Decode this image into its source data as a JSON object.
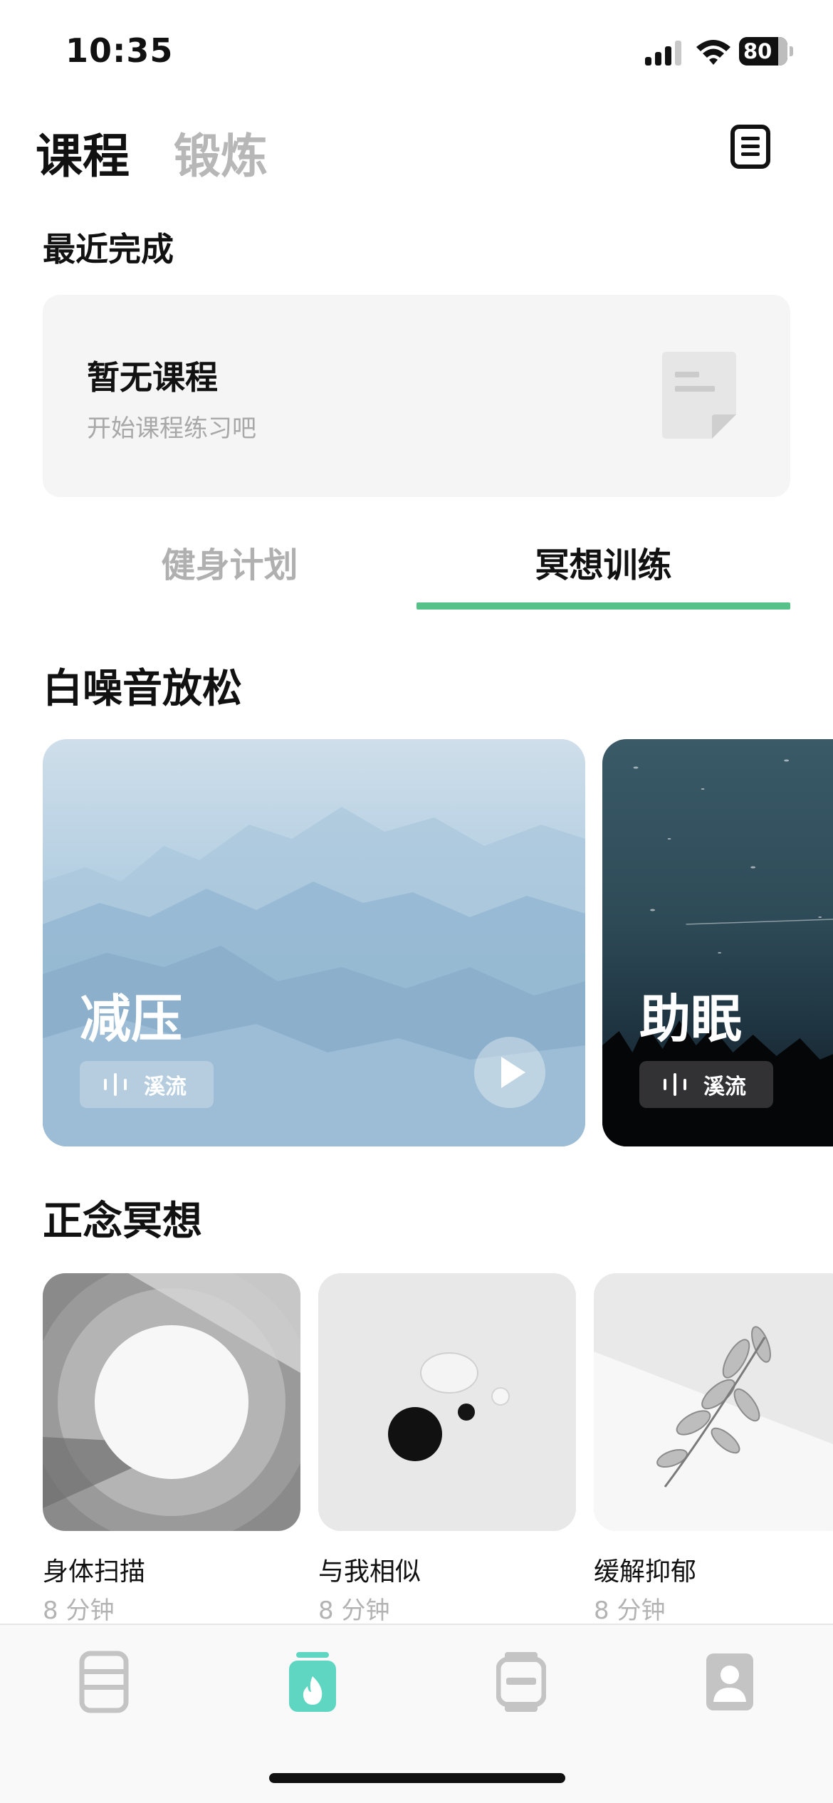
{
  "status_bar": {
    "time": "10:35",
    "battery": "80",
    "icons": [
      "signal-icon",
      "wifi-icon",
      "battery-icon"
    ]
  },
  "header": {
    "tabs": [
      {
        "label": "课程",
        "active": true
      },
      {
        "label": "锻炼",
        "active": false
      }
    ],
    "action_icon": "document-icon"
  },
  "recent": {
    "title": "最近完成",
    "empty_title": "暂无课程",
    "empty_subtitle": "开始课程练习吧",
    "icon": "document-icon"
  },
  "segment_tabs": [
    {
      "label": "健身计划",
      "active": false
    },
    {
      "label": "冥想训练",
      "active": true
    }
  ],
  "colors": {
    "accent": "#56c28a",
    "tab_active": "#5fd6c2",
    "muted": "#b0b0b0"
  },
  "white_noise": {
    "title": "白噪音放松",
    "cards": [
      {
        "title": "减压",
        "tag": "溪流",
        "icon": "sound-wave-icon",
        "play_icon": "play-icon"
      },
      {
        "title": "助眠",
        "tag": "溪流",
        "icon": "sound-wave-icon"
      }
    ]
  },
  "mindfulness": {
    "title": "正念冥想",
    "items": [
      {
        "name": "身体扫描",
        "duration": "8 分钟"
      },
      {
        "name": "与我相似",
        "duration": "8 分钟"
      },
      {
        "name": "缓解抑郁",
        "duration": "8 分钟"
      }
    ]
  },
  "tab_bar": {
    "items": [
      {
        "icon": "list-icon",
        "active": false
      },
      {
        "icon": "flame-icon",
        "active": true
      },
      {
        "icon": "watch-icon",
        "active": false
      },
      {
        "icon": "profile-icon",
        "active": false
      }
    ]
  }
}
